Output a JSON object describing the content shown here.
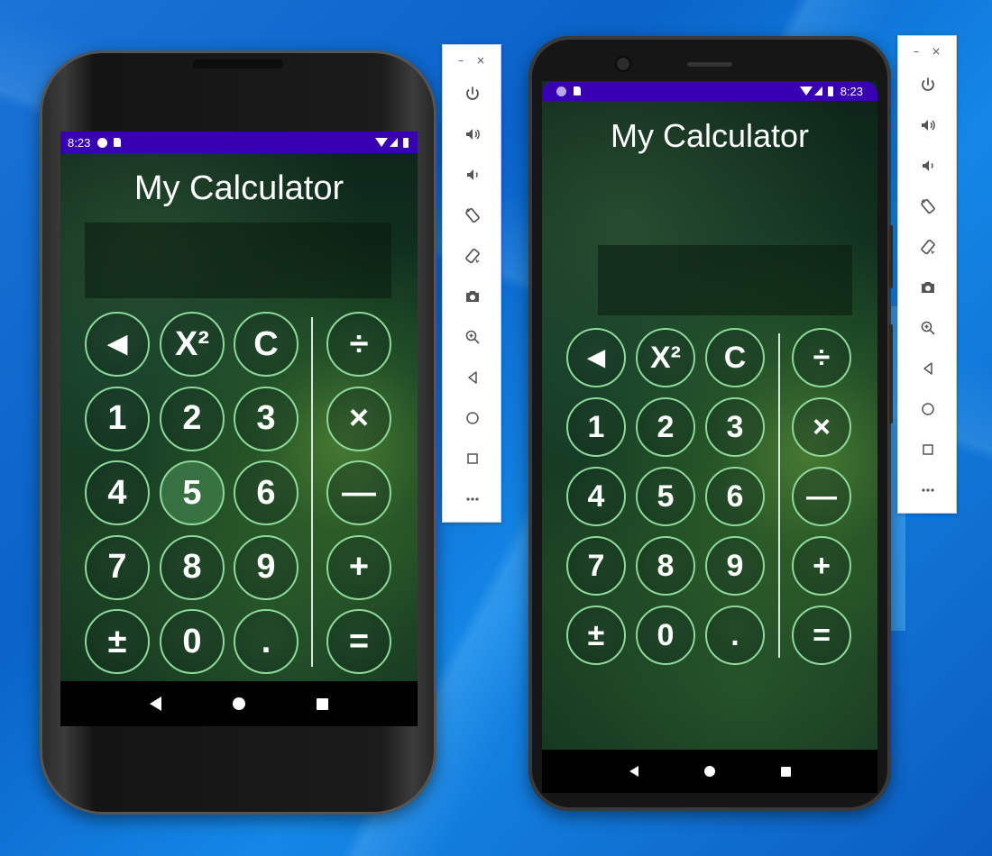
{
  "app": {
    "title": "My Calculator"
  },
  "device_a": {
    "statusbar": {
      "time": "8:23"
    },
    "keys": [
      {
        "label": "◄",
        "name": "key-backspace"
      },
      {
        "label": "X²",
        "name": "key-square"
      },
      {
        "label": "C",
        "name": "key-clear"
      },
      {
        "label": "÷",
        "name": "key-divide"
      },
      {
        "label": "1",
        "name": "key-1"
      },
      {
        "label": "2",
        "name": "key-2"
      },
      {
        "label": "3",
        "name": "key-3"
      },
      {
        "label": "×",
        "name": "key-multiply"
      },
      {
        "label": "4",
        "name": "key-4"
      },
      {
        "label": "5",
        "name": "key-5"
      },
      {
        "label": "6",
        "name": "key-6"
      },
      {
        "label": "—",
        "name": "key-subtract"
      },
      {
        "label": "7",
        "name": "key-7"
      },
      {
        "label": "8",
        "name": "key-8"
      },
      {
        "label": "9",
        "name": "key-9"
      },
      {
        "label": "+",
        "name": "key-add"
      },
      {
        "label": "±",
        "name": "key-negate"
      },
      {
        "label": "0",
        "name": "key-0"
      },
      {
        "label": ".",
        "name": "key-decimal"
      },
      {
        "label": "=",
        "name": "key-equals"
      }
    ],
    "pressed_key": "5"
  },
  "device_b": {
    "statusbar": {
      "time": "8:23"
    },
    "keys": [
      {
        "label": "◄",
        "name": "key-backspace"
      },
      {
        "label": "X²",
        "name": "key-square"
      },
      {
        "label": "C",
        "name": "key-clear"
      },
      {
        "label": "÷",
        "name": "key-divide"
      },
      {
        "label": "1",
        "name": "key-1"
      },
      {
        "label": "2",
        "name": "key-2"
      },
      {
        "label": "3",
        "name": "key-3"
      },
      {
        "label": "×",
        "name": "key-multiply"
      },
      {
        "label": "4",
        "name": "key-4"
      },
      {
        "label": "5",
        "name": "key-5"
      },
      {
        "label": "6",
        "name": "key-6"
      },
      {
        "label": "—",
        "name": "key-subtract"
      },
      {
        "label": "7",
        "name": "key-7"
      },
      {
        "label": "8",
        "name": "key-8"
      },
      {
        "label": "9",
        "name": "key-9"
      },
      {
        "label": "+",
        "name": "key-add"
      },
      {
        "label": "±",
        "name": "key-negate"
      },
      {
        "label": "0",
        "name": "key-0"
      },
      {
        "label": ".",
        "name": "key-decimal"
      },
      {
        "label": "=",
        "name": "key-equals"
      }
    ]
  },
  "emulator_toolbar": {
    "window_controls": [
      "–",
      "×"
    ],
    "buttons": [
      "power-icon",
      "volume-up-icon",
      "volume-down-icon",
      "rotate-left-icon",
      "rotate-right-icon",
      "camera-icon",
      "zoom-icon",
      "back-icon",
      "home-icon",
      "overview-icon",
      "more-icon"
    ]
  },
  "colors": {
    "status_bar": "#3700b3",
    "key_border": "#8dd99a",
    "desktop": "#0a63c9"
  }
}
